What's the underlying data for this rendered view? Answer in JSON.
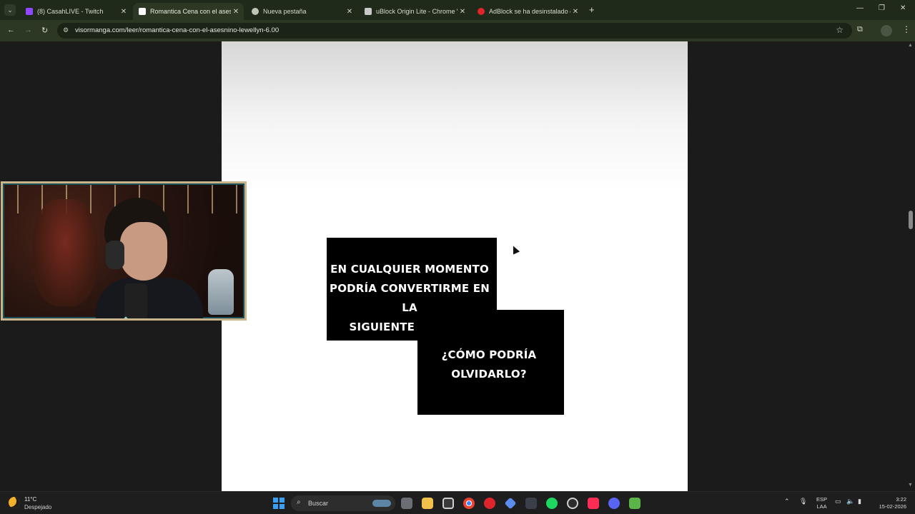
{
  "browser": {
    "tabs": [
      {
        "title": "(8) CasahLIVE - Twitch",
        "favicon_color": "#9146ff",
        "close": "✕"
      },
      {
        "title": "Romantica Cena con el asesnino",
        "favicon_color": "#ffffff",
        "close": "✕",
        "active": true
      },
      {
        "title": "Nueva pestaña",
        "favicon_color": "#bfc6b8",
        "close": "✕"
      },
      {
        "title": "uBlock Origin Lite - Chrome We",
        "favicon_color": "#c9c9c9",
        "close": "✕"
      },
      {
        "title": "AdBlock se ha desinstalado cor",
        "favicon_color": "#e0242b",
        "close": "✕"
      }
    ],
    "new_tab": "+",
    "url": "visormanga.com/leer/romantica-cena-con-el-asesnino-lewellyn-6.00",
    "window_controls": {
      "minimize": "—",
      "restore": "❐",
      "close": "✕"
    },
    "nav": {
      "back": "←",
      "forward": "→",
      "reload": "↻"
    }
  },
  "page": {
    "panel1_text": "EN CUALQUIER MOMENTO\nPODRÍA CONVERTIRME EN LA\nSIGUIENTE VÍCTIMA",
    "panel2_text": "¿CÓMO PODRÍA\nOLVIDARLO?",
    "page_background": "#ffffff"
  },
  "colors": {
    "tab_strip": "#1f2a1a",
    "toolbar": "#2c3824",
    "panel": "#000000",
    "webcam_border": "#c9b38a"
  },
  "taskbar": {
    "weather_temp": "11°C",
    "weather_desc": "Despejado",
    "search_label": "Buscar",
    "lang_top": "ESP",
    "lang_bottom": "LAA",
    "time": "3:22",
    "date": "15-02-2026",
    "apps": [
      "file-explorer-icon",
      "store-icon",
      "chrome-icon",
      "opera-icon",
      "app-icon",
      "code-icon",
      "spotify-icon",
      "steam-icon",
      "tiktok-icon",
      "discord-icon",
      "minecraft-icon"
    ]
  }
}
